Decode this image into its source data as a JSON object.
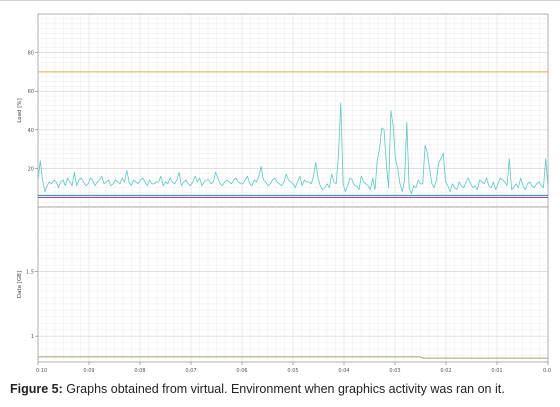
{
  "caption": {
    "label": "Figure 5:",
    "text": "Graphs obtained from virtual. Environment when graphics activity was ran on it."
  },
  "chart_data": [
    {
      "type": "line",
      "ylabel": "Load [%]",
      "ylim": [
        0,
        100
      ],
      "yticks": [
        20,
        40,
        60,
        80
      ],
      "grid": true,
      "x": [
        "0:10",
        "0:09",
        "0:08",
        "0:07",
        "0:06",
        "0:05",
        "0:04",
        "0:03",
        "0:02",
        "0:01",
        "0:0"
      ],
      "series": [
        {
          "color": "#e8a84a",
          "values": [
            70,
            70,
            70,
            70,
            70,
            70,
            70,
            70,
            70,
            70,
            70,
            70,
            70,
            70,
            70,
            70,
            70,
            70,
            70,
            70,
            70,
            70,
            70,
            70,
            70,
            70,
            70,
            70,
            70,
            70,
            70,
            70,
            70,
            70,
            70,
            70,
            70,
            70,
            70,
            70,
            70,
            70,
            70,
            70,
            70,
            70,
            70,
            70,
            70,
            70,
            70,
            70,
            70,
            70,
            70,
            70,
            70,
            70,
            70,
            70,
            70,
            70,
            70,
            70,
            70,
            70,
            70,
            70,
            70,
            70,
            70,
            70,
            70,
            70,
            70,
            70,
            70,
            70,
            70,
            70,
            70,
            70,
            70,
            70,
            70,
            70,
            70,
            70,
            70,
            70,
            70,
            70,
            70,
            70,
            70,
            70,
            70,
            70,
            70,
            70,
            70,
            70,
            70,
            70,
            70,
            70,
            70,
            70,
            70,
            70,
            70,
            70,
            70,
            70,
            70,
            70,
            70,
            70,
            70,
            70
          ]
        },
        {
          "color": "#5cc8c0",
          "values": [
            14,
            24,
            14,
            8,
            11,
            13,
            12,
            14,
            13,
            10,
            13,
            14,
            11,
            15,
            13,
            11,
            18,
            11,
            14,
            15,
            13,
            11,
            12,
            15,
            14,
            11,
            13,
            14,
            16,
            12,
            13,
            14,
            11,
            12,
            14,
            13,
            12,
            15,
            13,
            19,
            13,
            11,
            14,
            13,
            12,
            14,
            15,
            13,
            11,
            14,
            12,
            12,
            13,
            13,
            16,
            11,
            13,
            12,
            15,
            13,
            12,
            14,
            18,
            11,
            13,
            14,
            12,
            11,
            13,
            16,
            13,
            15,
            11,
            13,
            14,
            14,
            12,
            13,
            18,
            15,
            12,
            11,
            13,
            14,
            13,
            12,
            14,
            15,
            13,
            12,
            12,
            14,
            16,
            12,
            11,
            14,
            13,
            16,
            21,
            14,
            13,
            11,
            12,
            14,
            15,
            13,
            12,
            11,
            13,
            17,
            14,
            13,
            12,
            10,
            13,
            16,
            11,
            14,
            13,
            13,
            12,
            16,
            23,
            15,
            11,
            9,
            10,
            12,
            10,
            17,
            13,
            12,
            28,
            54,
            12,
            8,
            11,
            15,
            14,
            11,
            11,
            9,
            16,
            13,
            12,
            11,
            9,
            15,
            9,
            24,
            30,
            41,
            40,
            22,
            10,
            50,
            42,
            25,
            20,
            12,
            8,
            14,
            44,
            10,
            7,
            11,
            10,
            14,
            12,
            12,
            32,
            28,
            20,
            12,
            10,
            14,
            23,
            25,
            28,
            13,
            11,
            8,
            12,
            10,
            9,
            13,
            11,
            10,
            13,
            15,
            12,
            10,
            11,
            9,
            14,
            13,
            12,
            15,
            11,
            10,
            13,
            9,
            12,
            15,
            14,
            13,
            11,
            25,
            9,
            10,
            12,
            10,
            15,
            11,
            9,
            12,
            13,
            11,
            10,
            12,
            13,
            11,
            10,
            25,
            10
          ]
        },
        {
          "color": "#7a3fa0",
          "values": [
            5,
            5,
            5,
            5,
            5,
            5,
            5,
            5,
            5,
            5,
            5,
            5,
            5,
            5,
            5,
            5,
            5,
            5,
            5,
            5,
            5,
            5,
            5,
            5,
            5,
            5,
            5,
            5,
            5,
            5,
            5,
            5,
            5,
            5,
            5,
            5,
            5,
            5,
            5,
            5,
            5,
            5,
            5,
            5,
            5,
            5,
            5,
            5,
            5,
            5,
            5,
            5,
            5,
            5,
            5,
            5,
            5,
            5,
            5,
            5,
            5,
            5,
            5,
            5,
            5,
            5,
            5,
            5,
            5,
            5,
            5,
            5,
            5,
            5,
            5,
            5,
            5,
            5,
            5,
            5,
            5,
            5,
            5,
            5,
            5,
            5,
            5,
            5,
            5,
            5,
            5,
            5,
            5,
            5,
            5,
            5,
            5,
            5,
            5,
            5,
            5,
            5,
            5,
            5,
            5,
            5,
            5,
            5,
            5,
            5,
            5,
            5,
            5,
            5,
            5,
            5,
            5,
            5,
            5,
            5
          ]
        },
        {
          "color": "#2e8b8b",
          "values": [
            6,
            6,
            6,
            6,
            6,
            6,
            6,
            6,
            6,
            6,
            6,
            6,
            6,
            6,
            6,
            6,
            6,
            6,
            6,
            6,
            6,
            6,
            6,
            6,
            6,
            6,
            6,
            6,
            6,
            6,
            6,
            6,
            6,
            6,
            6,
            6,
            6,
            6,
            6,
            6,
            6,
            6,
            6,
            6,
            6,
            6,
            6,
            6,
            6,
            6,
            6,
            6,
            6,
            6,
            6,
            6,
            6,
            6,
            6,
            6,
            6,
            6,
            6,
            6,
            6,
            6,
            6,
            6,
            6,
            6,
            6,
            6,
            6,
            6,
            6,
            6,
            6,
            6,
            6,
            6,
            6,
            6,
            6,
            6,
            6,
            6,
            6,
            6,
            6,
            6,
            6,
            6,
            6,
            6,
            6,
            6,
            6,
            6,
            6,
            6,
            6,
            6,
            6,
            6,
            6,
            6,
            6,
            6,
            6,
            6,
            6,
            6,
            6,
            6,
            6,
            6,
            6,
            6,
            6,
            6
          ]
        }
      ]
    },
    {
      "type": "line",
      "ylabel": "Data [GB]",
      "ylim": [
        0.8,
        2.0
      ],
      "yticks": [
        1,
        1.5
      ],
      "grid": true,
      "x": [
        "0:10",
        "0:09",
        "0:08",
        "0:07",
        "0:06",
        "0:05",
        "0:04",
        "0:03",
        "0:02",
        "0:01",
        "0:0"
      ],
      "series": [
        {
          "color": "#a8a070",
          "values": [
            0.84,
            0.84,
            0.84,
            0.84,
            0.84,
            0.84,
            0.84,
            0.84,
            0.84,
            0.84,
            0.84,
            0.84,
            0.84,
            0.84,
            0.84,
            0.84,
            0.84,
            0.84,
            0.84,
            0.84,
            0.84,
            0.84,
            0.84,
            0.84,
            0.84,
            0.84,
            0.84,
            0.84,
            0.84,
            0.84,
            0.84,
            0.84,
            0.84,
            0.84,
            0.84,
            0.84,
            0.84,
            0.84,
            0.84,
            0.84,
            0.84,
            0.84,
            0.84,
            0.84,
            0.84,
            0.84,
            0.84,
            0.84,
            0.84,
            0.84,
            0.84,
            0.84,
            0.84,
            0.84,
            0.84,
            0.84,
            0.84,
            0.84,
            0.84,
            0.84,
            0.84,
            0.84,
            0.84,
            0.84,
            0.84,
            0.84,
            0.84,
            0.84,
            0.84,
            0.84,
            0.84,
            0.84,
            0.84,
            0.84,
            0.84,
            0.84,
            0.84,
            0.84,
            0.84,
            0.84,
            0.84,
            0.84,
            0.84,
            0.84,
            0.84,
            0.84,
            0.84,
            0.84,
            0.84,
            0.84,
            0.83,
            0.83,
            0.83,
            0.83,
            0.83,
            0.83,
            0.83,
            0.83,
            0.83,
            0.83,
            0.83,
            0.83,
            0.83,
            0.83,
            0.83,
            0.83,
            0.83,
            0.83,
            0.83,
            0.83,
            0.83,
            0.83,
            0.83,
            0.83,
            0.83,
            0.83,
            0.83,
            0.83,
            0.83,
            0.83
          ]
        }
      ]
    }
  ]
}
